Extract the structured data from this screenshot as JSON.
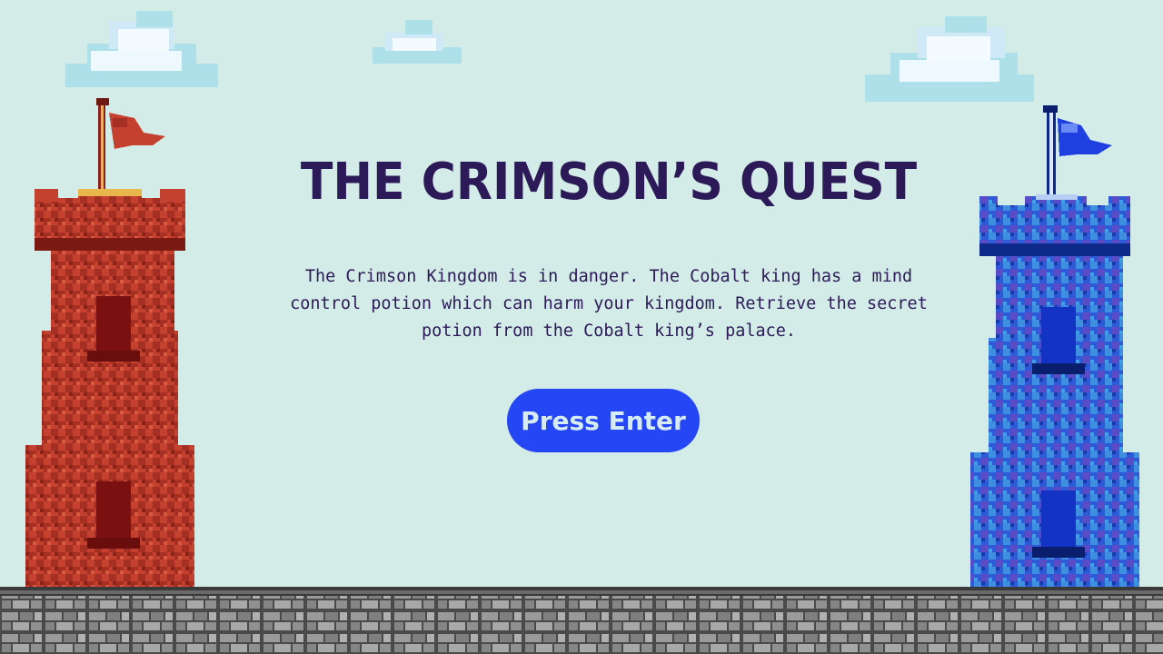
{
  "title": "THE CRIMSON’S QUEST",
  "intro": "The Crimson Kingdom is in danger. The Cobalt king has a mind control potion which can harm your kingdom. Retrieve the secret potion from the Cobalt king’s palace.",
  "start_button": {
    "label": "Press Enter"
  },
  "colors": {
    "background": "#d4ece8",
    "title": "#2b1a57",
    "button": "#2446f5",
    "button_text": "#d7ecf0",
    "crimson_tower": "#c0402e",
    "cobalt_tower": "#2458d8"
  },
  "scene": {
    "left_tower": "crimson-tower",
    "right_tower": "cobalt-tower",
    "ground": "cobblestone-ground",
    "clouds": 3
  }
}
